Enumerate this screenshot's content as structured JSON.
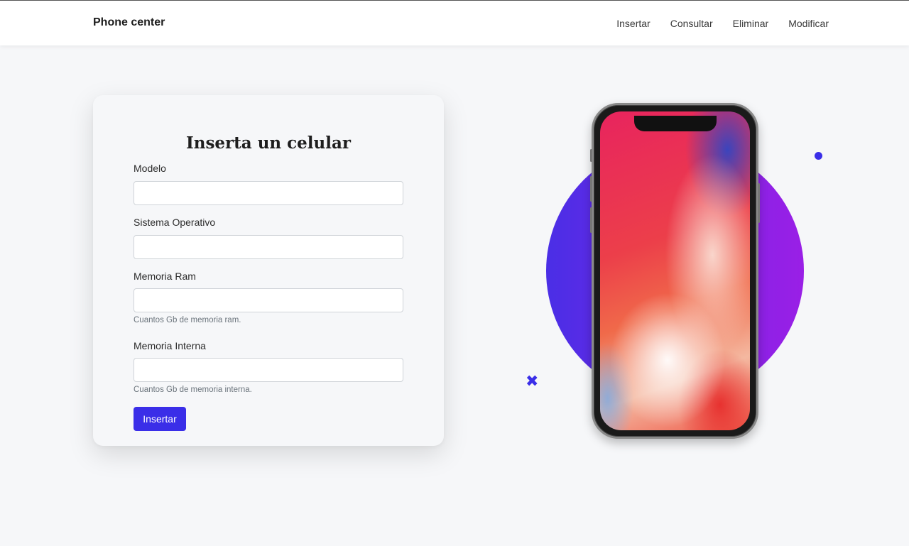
{
  "navbar": {
    "brand": "Phone center",
    "links": [
      "Insertar",
      "Consultar",
      "Eliminar",
      "Modificar"
    ]
  },
  "form": {
    "title": "Inserta un celular",
    "fields": [
      {
        "label": "Modelo",
        "value": "",
        "help": ""
      },
      {
        "label": "Sistema Operativo",
        "value": "",
        "help": ""
      },
      {
        "label": "Memoria Ram",
        "value": "",
        "help": "Cuantos Gb de memoria ram."
      },
      {
        "label": "Memoria Interna",
        "value": "",
        "help": "Cuantos Gb de memoria interna."
      }
    ],
    "submit_label": "Insertar"
  },
  "icons": {
    "cross": "✖"
  },
  "colors": {
    "accent": "#3a2ee8",
    "background": "#f6f7f9"
  }
}
